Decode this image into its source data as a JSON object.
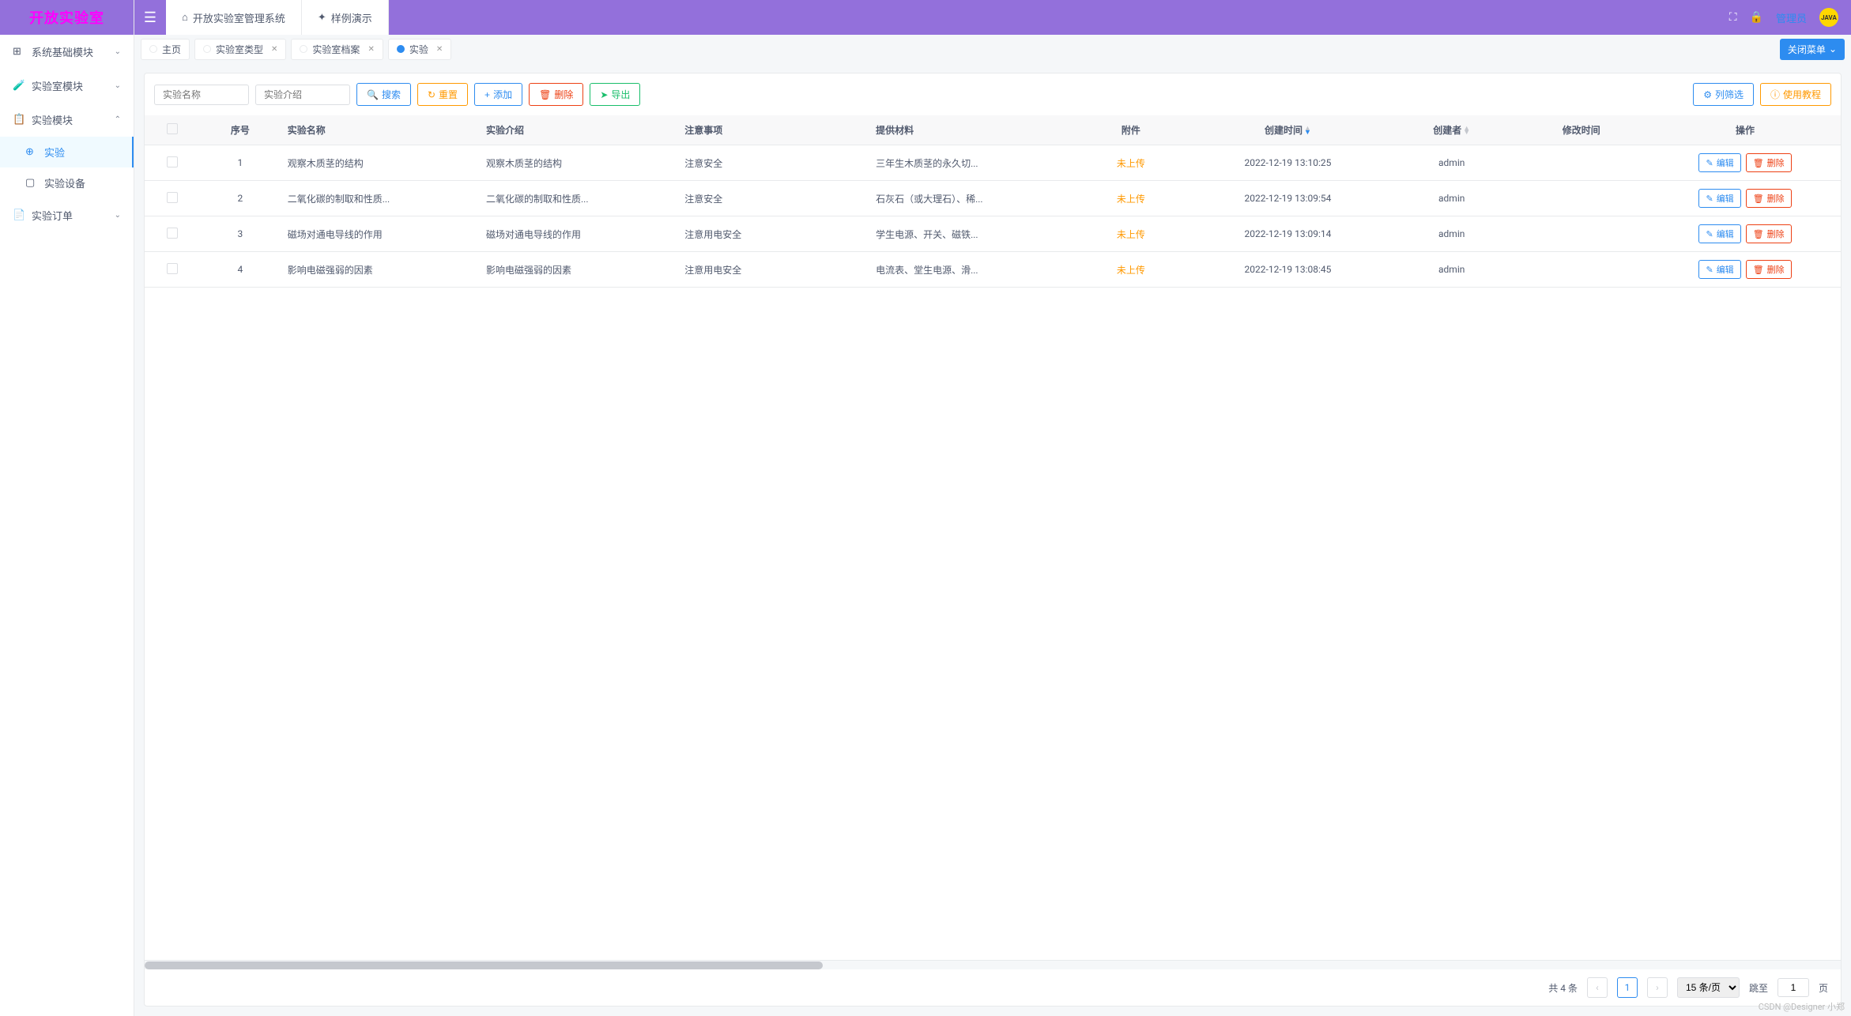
{
  "logo": "开放实验室",
  "sidebar": {
    "items": [
      {
        "icon": "⊞",
        "label": "系统基础模块",
        "expanded": false
      },
      {
        "icon": "🧪",
        "label": "实验室模块",
        "expanded": false
      },
      {
        "icon": "📋",
        "label": "实验模块",
        "expanded": true,
        "children": [
          {
            "icon": "⊕",
            "label": "实验",
            "active": true
          },
          {
            "icon": "▢",
            "label": "实验设备",
            "active": false
          }
        ]
      },
      {
        "icon": "📄",
        "label": "实验订单",
        "expanded": false
      }
    ]
  },
  "header": {
    "tabs": [
      {
        "icon": "⌂",
        "label": "开放实验室管理系统"
      },
      {
        "icon": "✦",
        "label": "样例演示"
      }
    ],
    "user": "管理员",
    "avatar": "JAVA"
  },
  "tabs": [
    {
      "label": "主页",
      "active": false,
      "closable": false
    },
    {
      "label": "实验室类型",
      "active": false,
      "closable": true
    },
    {
      "label": "实验室档案",
      "active": false,
      "closable": true
    },
    {
      "label": "实验",
      "active": true,
      "closable": true
    }
  ],
  "close_menu_label": "关闭菜单",
  "toolbar": {
    "search_name_placeholder": "实验名称",
    "search_intro_placeholder": "实验介绍",
    "search": "搜索",
    "reset": "重置",
    "add": "添加",
    "delete": "删除",
    "export": "导出",
    "filter_cols": "列筛选",
    "tutorial": "使用教程"
  },
  "table": {
    "columns": {
      "seq": "序号",
      "name": "实验名称",
      "intro": "实验介绍",
      "notes": "注意事项",
      "materials": "提供材料",
      "attachment": "附件",
      "created": "创建时间",
      "creator": "创建者",
      "modified": "修改时间",
      "ops": "操作"
    },
    "op_edit": "编辑",
    "op_delete": "删除",
    "rows": [
      {
        "seq": "1",
        "name": "观察木质茎的结构",
        "intro": "观察木质茎的结构",
        "notes": "注意安全",
        "materials": "三年生木质茎的永久切...",
        "attachment": "未上传",
        "created": "2022-12-19 13:10:25",
        "creator": "admin",
        "modified": ""
      },
      {
        "seq": "2",
        "name": "二氧化碳的制取和性质...",
        "intro": "二氧化碳的制取和性质...",
        "notes": "注意安全",
        "materials": "石灰石（或大理石）、稀...",
        "attachment": "未上传",
        "created": "2022-12-19 13:09:54",
        "creator": "admin",
        "modified": ""
      },
      {
        "seq": "3",
        "name": "磁场对通电导线的作用",
        "intro": "磁场对通电导线的作用",
        "notes": "注意用电安全",
        "materials": "学生电源、开关、磁铁...",
        "attachment": "未上传",
        "created": "2022-12-19 13:09:14",
        "creator": "admin",
        "modified": ""
      },
      {
        "seq": "4",
        "name": "影响电磁强弱的因素",
        "intro": "影响电磁强弱的因素",
        "notes": "注意用电安全",
        "materials": "电流表、堂生电源、滑...",
        "attachment": "未上传",
        "created": "2022-12-19 13:08:45",
        "creator": "admin",
        "modified": ""
      }
    ]
  },
  "pagination": {
    "total_text": "共 4 条",
    "page": "1",
    "per_page": "15 条/页",
    "jump_label": "跳至",
    "page_suffix": "页",
    "jump_value": "1"
  },
  "watermark": "CSDN @Designer 小郑"
}
